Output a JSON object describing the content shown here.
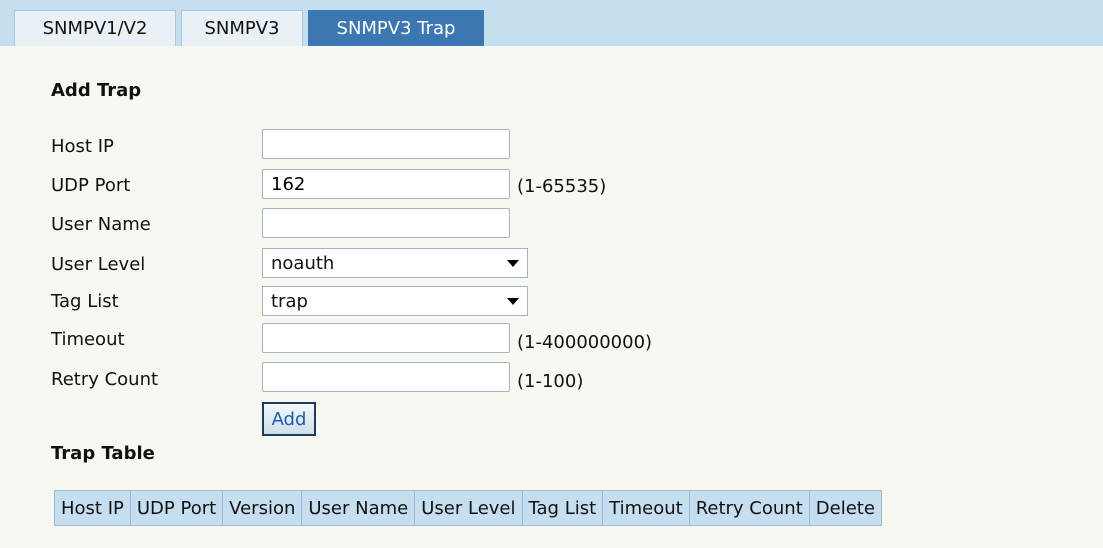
{
  "tabs": [
    {
      "label": "SNMPV1/V2"
    },
    {
      "label": "SNMPV3"
    },
    {
      "label": "SNMPV3 Trap"
    }
  ],
  "add_trap": {
    "title": "Add Trap",
    "host_ip": {
      "label": "Host IP",
      "value": ""
    },
    "udp_port": {
      "label": "UDP Port",
      "value": "162",
      "hint": "(1-65535)"
    },
    "user_name": {
      "label": "User Name",
      "value": ""
    },
    "user_level": {
      "label": "User Level",
      "value": "noauth"
    },
    "tag_list": {
      "label": "Tag List",
      "value": "trap"
    },
    "timeout": {
      "label": "Timeout",
      "value": "",
      "hint": "(1-400000000)"
    },
    "retry_count": {
      "label": "Retry Count",
      "value": "",
      "hint": "(1-100)"
    },
    "add_button": "Add"
  },
  "trap_table": {
    "title": "Trap Table",
    "columns": [
      "Host IP",
      "UDP Port",
      "Version",
      "User Name",
      "User Level",
      "Tag List",
      "Timeout",
      "Retry Count",
      "Delete"
    ]
  }
}
